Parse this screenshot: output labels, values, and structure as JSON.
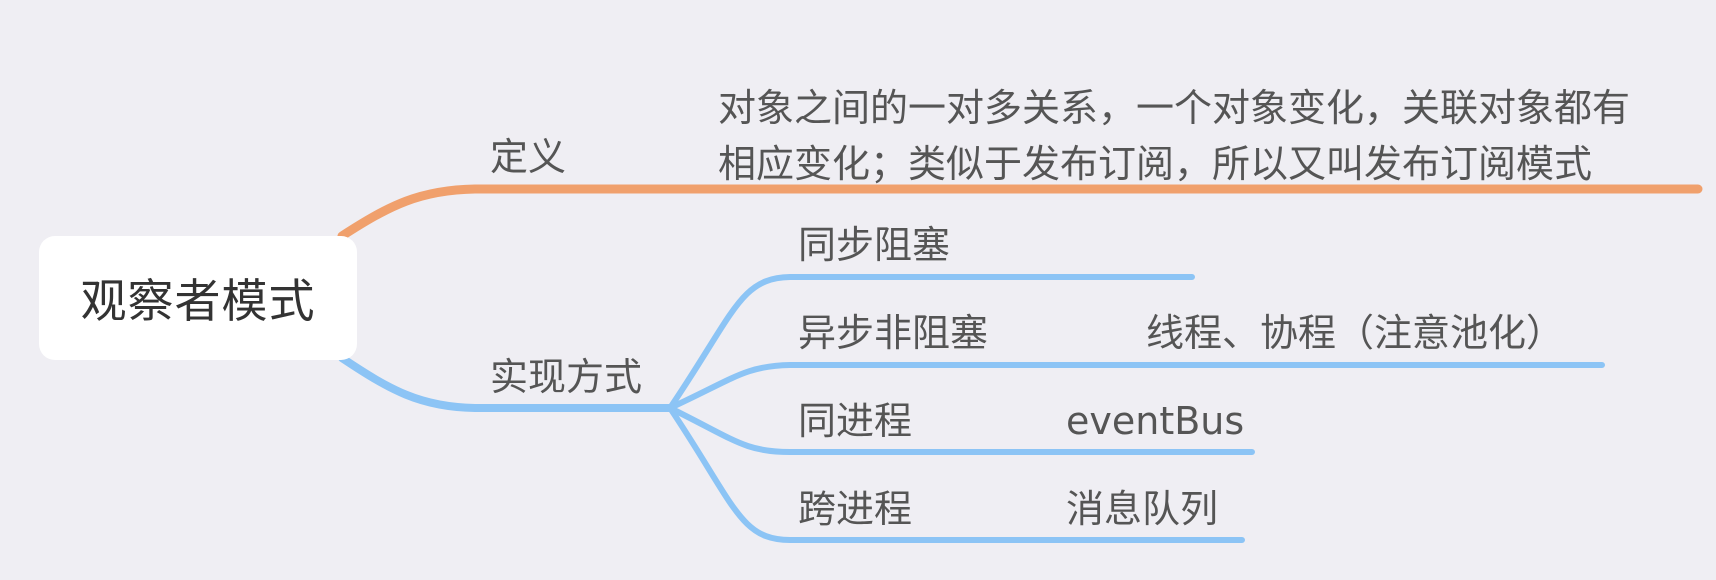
{
  "mindmap": {
    "root": "观察者模式",
    "branches": [
      {
        "label": "定义",
        "color": "#f0a06c",
        "note_lines": [
          "对象之间的一对多关系，一个对象变化，关联对象都有",
          "相应变化；类似于发布订阅，所以又叫发布订阅模式"
        ]
      },
      {
        "label": "实现方式",
        "color": "#8cc4f5",
        "children": [
          {
            "label": "同步阻塞"
          },
          {
            "label": "异步非阻塞",
            "detail": "线程、协程（注意池化）"
          },
          {
            "label": "同进程",
            "detail": "eventBus"
          },
          {
            "label": "跨进程",
            "detail": "消息队列"
          }
        ]
      }
    ]
  }
}
